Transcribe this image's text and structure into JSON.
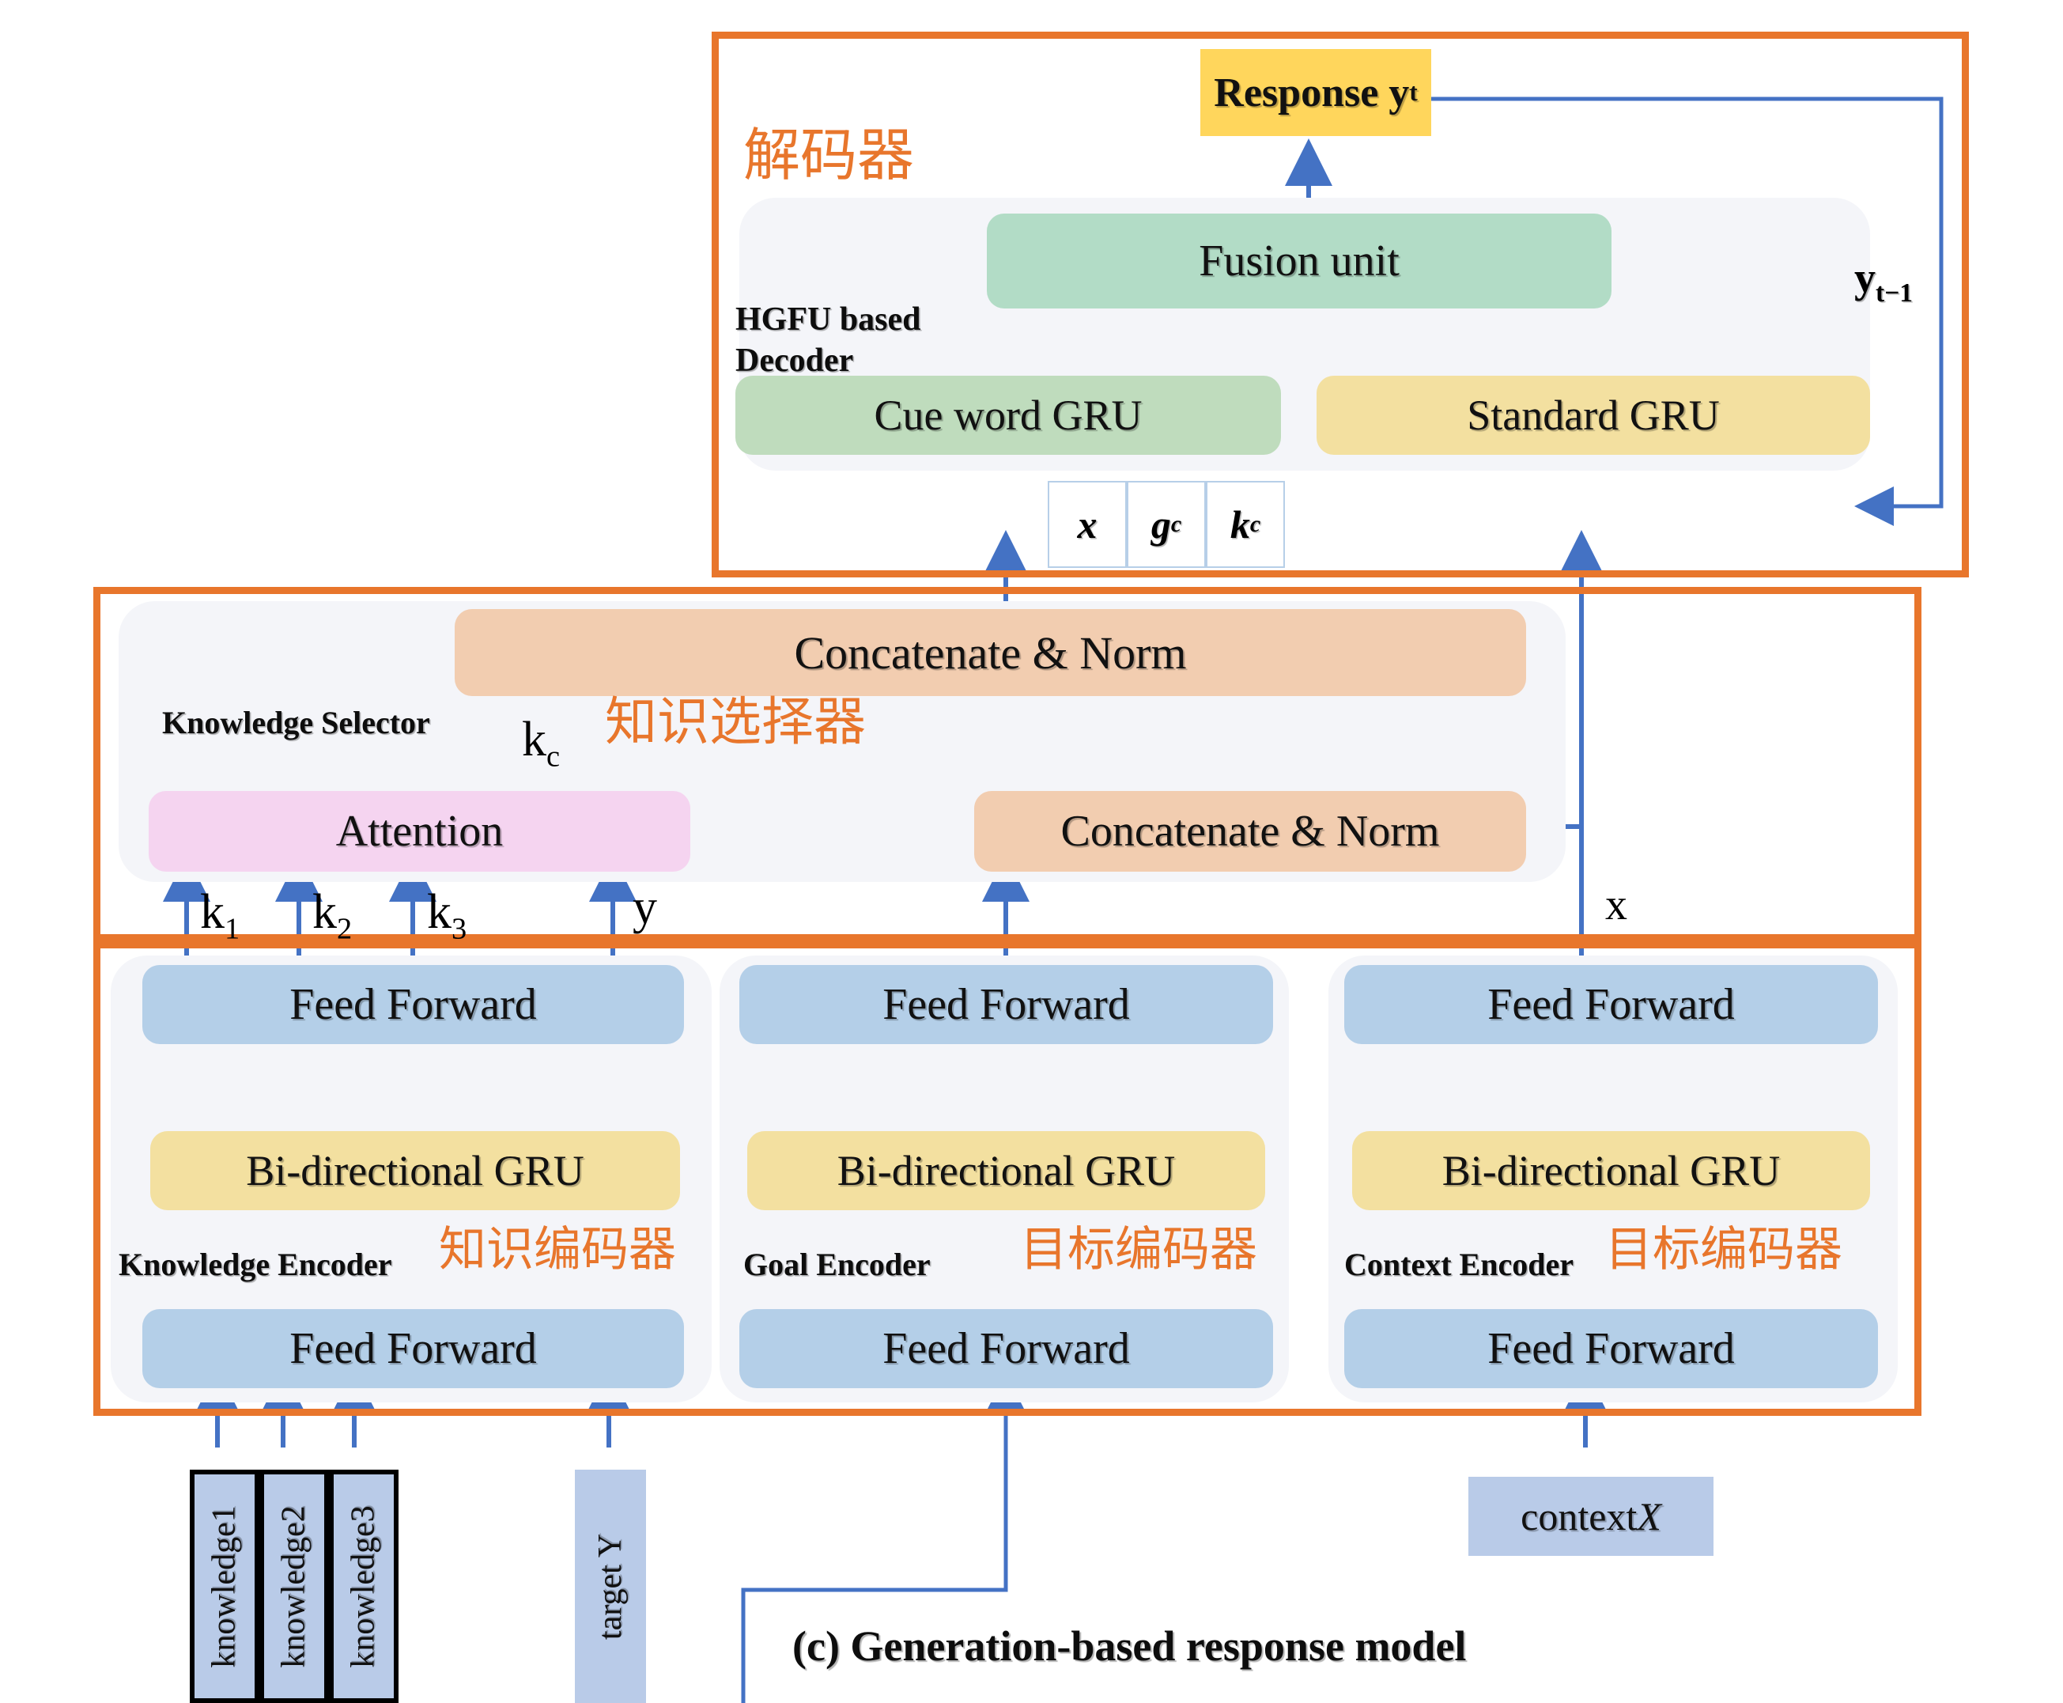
{
  "figure": {
    "caption": "(c) Generation-based response model"
  },
  "colors": {
    "frame_orange": "#e8762c",
    "wire_blue": "#4472c4",
    "feed_forward_blue": "#b4cfe8",
    "gru_yellow": "#f3e0a0",
    "cue_word_green": "#bfdcbd",
    "fusion_green": "#b2dcc6",
    "concat_peach": "#f2cdb0",
    "attention_pink": "#f5d4f0",
    "response_gold": "#ffd65c",
    "input_lavender": "#b9cbe8",
    "panel_grey": "#f4f5f9"
  },
  "decoder": {
    "section_label_cn": "解码器",
    "subsystem_label": "HGFU based\nDecoder",
    "subsystem_label_line1": "HGFU based",
    "subsystem_label_line2": "Decoder",
    "response_box": "Response y",
    "response_box_sub": "t",
    "fusion_unit": "Fusion unit",
    "cue_word_gru": "Cue word GRU",
    "standard_gru": "Standard GRU",
    "feedback_label": "y",
    "feedback_label_sub": "t−1",
    "cells": [
      {
        "base": "x",
        "sub": ""
      },
      {
        "base": "g",
        "sub": "c"
      },
      {
        "base": "k",
        "sub": "c"
      }
    ]
  },
  "knowledge_selector": {
    "section_label_cn": "知识选择器",
    "subsystem_label": "Knowledge Selector",
    "concat_top": "Concatenate & Norm",
    "concat_mid": "Concatenate & Norm",
    "attention": "Attention",
    "kc_label": "k",
    "kc_label_sub": "c",
    "input_labels": [
      {
        "base": "k",
        "sub": "1"
      },
      {
        "base": "k",
        "sub": "2"
      },
      {
        "base": "k",
        "sub": "3"
      },
      {
        "base": "y",
        "sub": ""
      }
    ],
    "x_label": "x"
  },
  "encoders": [
    {
      "name": "knowledge-encoder",
      "subsystem_label": "Knowledge Encoder",
      "section_label_cn": "知识编码器",
      "top_block": "Feed Forward",
      "mid_block": "Bi-directional GRU",
      "bottom_block": "Feed Forward"
    },
    {
      "name": "goal-encoder",
      "subsystem_label": "Goal Encoder",
      "section_label_cn": "目标编码器",
      "top_block": "Feed Forward",
      "mid_block": "Bi-directional GRU",
      "bottom_block": "Feed Forward"
    },
    {
      "name": "context-encoder",
      "subsystem_label": "Context Encoder",
      "section_label_cn": "目标编码器",
      "top_block": "Feed Forward",
      "mid_block": "Bi-directional GRU",
      "bottom_block": "Feed Forward"
    }
  ],
  "inputs": {
    "knowledge": [
      "knowledge1",
      "knowledge2",
      "knowledge3"
    ],
    "target": "target Y",
    "context_prefix": "context ",
    "context_var": "X"
  }
}
